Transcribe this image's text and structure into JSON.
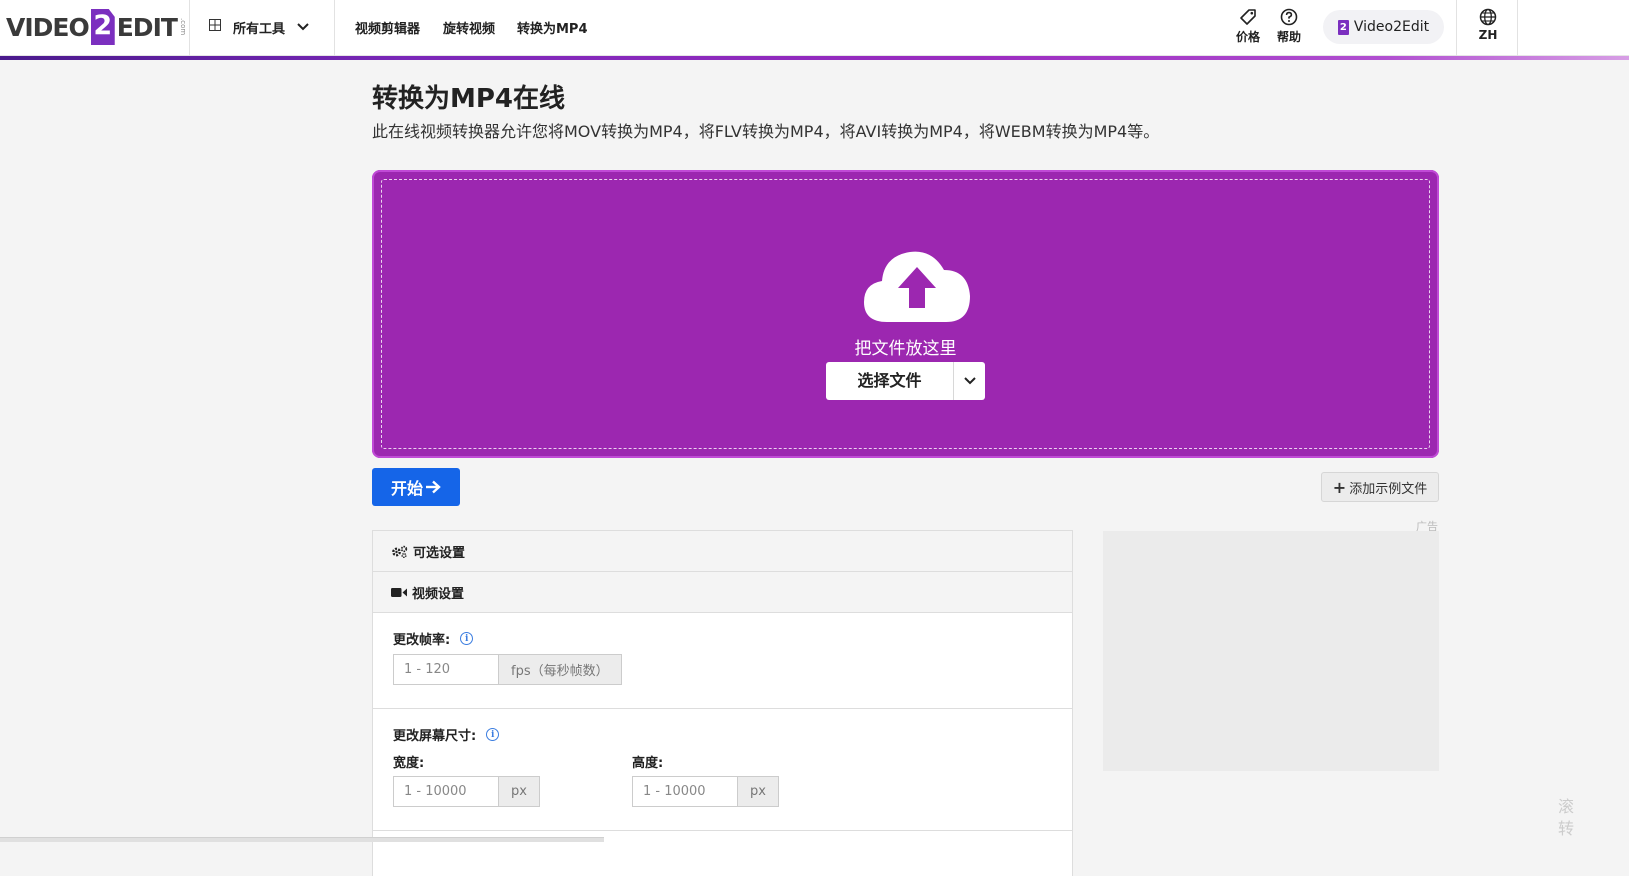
{
  "header": {
    "logo": {
      "part1": "VIDEO",
      "num": "2",
      "part2": "EDIT",
      "suffix": ".com"
    },
    "all_tools": "所有工具",
    "nav": [
      "视频剪辑器",
      "旋转视频",
      "转换为MP4"
    ],
    "pricing": "价格",
    "help": "帮助",
    "brand_button": "Video2Edit",
    "brand_icon": "2",
    "language": "ZH"
  },
  "page": {
    "title": "转换为MP4在线",
    "subtitle": "此在线视频转换器允许您将MOV转换为MP4，将FLV转换为MP4，将AVI转换为MP4，将WEBM转换为MP4等。"
  },
  "dropzone": {
    "drop_text": "把文件放这里",
    "choose_file": "选择文件",
    "bg_color": "#9c27b0"
  },
  "actions": {
    "start": "开始",
    "add_sample": "添加示例文件"
  },
  "ad": {
    "label": "广告"
  },
  "settings": {
    "optional_title": "可选设置",
    "video_settings_title": "视频设置",
    "frame_rate_label": "更改帧率:",
    "frame_rate_placeholder": "1 - 120",
    "frame_rate_suffix": "fps（每秒帧数）",
    "screen_size_label": "更改屏幕尺寸:",
    "width_label": "宽度:",
    "height_label": "高度:",
    "width_placeholder": "1 - 10000",
    "height_placeholder": "1 - 10000",
    "px_suffix": "px"
  },
  "edge_text": [
    "滚",
    "转"
  ],
  "colors": {
    "accent_purple": "#7b2fbf",
    "primary_blue": "#1565e8",
    "info_blue": "#3b7de0"
  }
}
